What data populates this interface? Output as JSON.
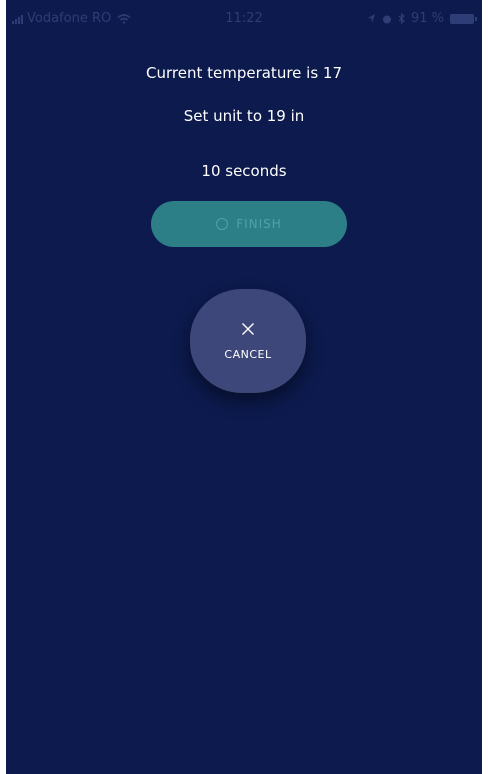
{
  "status_bar": {
    "carrier": "Vodafone RO",
    "time": "11:22",
    "battery": "91 %"
  },
  "main": {
    "current_temperature": "Current temperature is 17",
    "set_unit": "Set unit to 19 in",
    "countdown": "10 seconds"
  },
  "actions": {
    "finish_label": "FINISH",
    "cancel_label": "CANCEL"
  },
  "colors": {
    "background": "#0c1a4d",
    "finish_button": "#2c7f87",
    "cancel_button": "#3e4779"
  },
  "icons": {
    "finish": "spinner-icon",
    "cancel": "close-icon"
  }
}
